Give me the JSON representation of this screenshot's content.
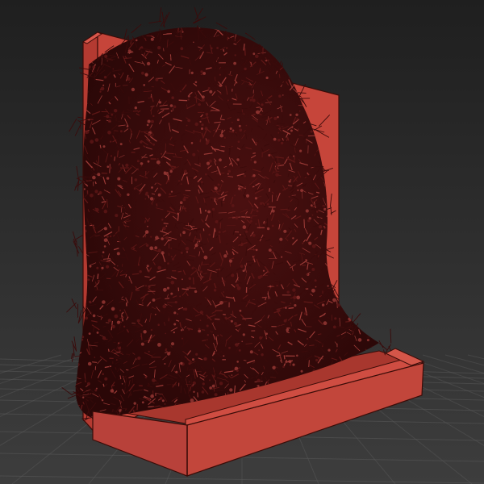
{
  "viewport": {
    "background_top": "#1f1f1f",
    "background_bottom": "#3d3d3d",
    "grid_color": "#5a5a5a",
    "grid_visible": true
  },
  "model": {
    "wall_color": "#c6453a",
    "wall_edge_color": "#3a0c08",
    "wall_side_color": "#b43a31",
    "planter_top_color": "#cf4d42",
    "planter_front_color": "#c2463b",
    "planter_inner_color": "#a8372e",
    "foliage_dark": "#3a0b0b",
    "foliage_mid": "#5e1716",
    "foliage_light": "#9a3a36",
    "wireframe_edges": true
  }
}
